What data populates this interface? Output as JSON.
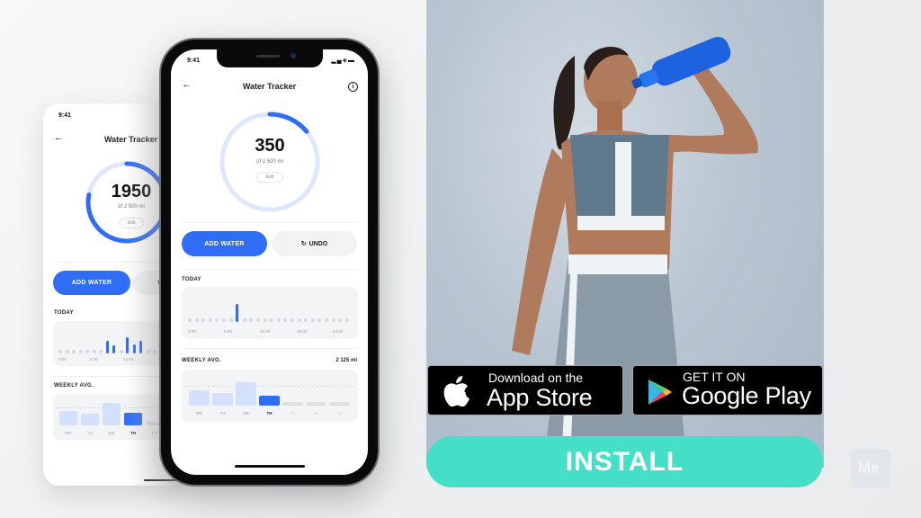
{
  "colors": {
    "accent": "#2f6df6",
    "accent_light": "#d4e1fd",
    "install": "#44dfc6",
    "badge_bg": "#000000"
  },
  "back_phone": {
    "status_time": "9:41",
    "nav": {
      "back_icon": "arrow-left-icon",
      "title": "Water Tracker"
    },
    "ring": {
      "value": "1950",
      "goal_text": "of 2 500 ml",
      "edit_label": "Edit",
      "progress": 0.78
    },
    "add_water_label": "ADD WATER",
    "today": {
      "label": "TODAY",
      "ticks": [
        "0:00",
        "6:00",
        "12:00",
        "18:00"
      ]
    },
    "weekly": {
      "label": "WEEKLY AVG.",
      "days": [
        "MO",
        "TU",
        "WE",
        "TH",
        "FR"
      ]
    }
  },
  "front_phone": {
    "status_time": "9:41",
    "status_icons": [
      "signal-icon",
      "wifi-icon",
      "battery-icon"
    ],
    "nav": {
      "back_icon": "arrow-left-icon",
      "title": "Water Tracker",
      "info_icon": "info-icon"
    },
    "ring": {
      "value": "350",
      "goal_text": "of 2 500 ml",
      "edit_label": "Edit",
      "progress": 0.14
    },
    "add_water_label": "ADD WATER",
    "undo_label": "UNDO",
    "today": {
      "label": "TODAY",
      "ticks": [
        "0:00",
        "6:00",
        "12:00",
        "18:00",
        "24:00"
      ],
      "active_slots": [
        7
      ]
    },
    "weekly": {
      "label": "WEEKLY AVG.",
      "value": "2 125 ml",
      "days": [
        {
          "label": "MO",
          "level": 0.55,
          "state": "past"
        },
        {
          "label": "TU",
          "level": 0.45,
          "state": "past"
        },
        {
          "label": "WE",
          "level": 0.85,
          "state": "past"
        },
        {
          "label": "TH",
          "level": 0.35,
          "state": "today"
        },
        {
          "label": "FR",
          "level": 0,
          "state": "future"
        },
        {
          "label": "SA",
          "level": 0,
          "state": "future"
        },
        {
          "label": "SU",
          "level": 0,
          "state": "future"
        }
      ]
    }
  },
  "promo": {
    "photo_alt": "Woman in sportswear drinking from a blue water bottle",
    "app_store": {
      "icon": "apple-icon",
      "small": "Download on the",
      "big": "App Store"
    },
    "google_play": {
      "icon": "google-play-icon",
      "small": "GET IT ON",
      "big": "Google Play"
    },
    "install_label": "INSTALL",
    "brand_logo": "Me."
  }
}
